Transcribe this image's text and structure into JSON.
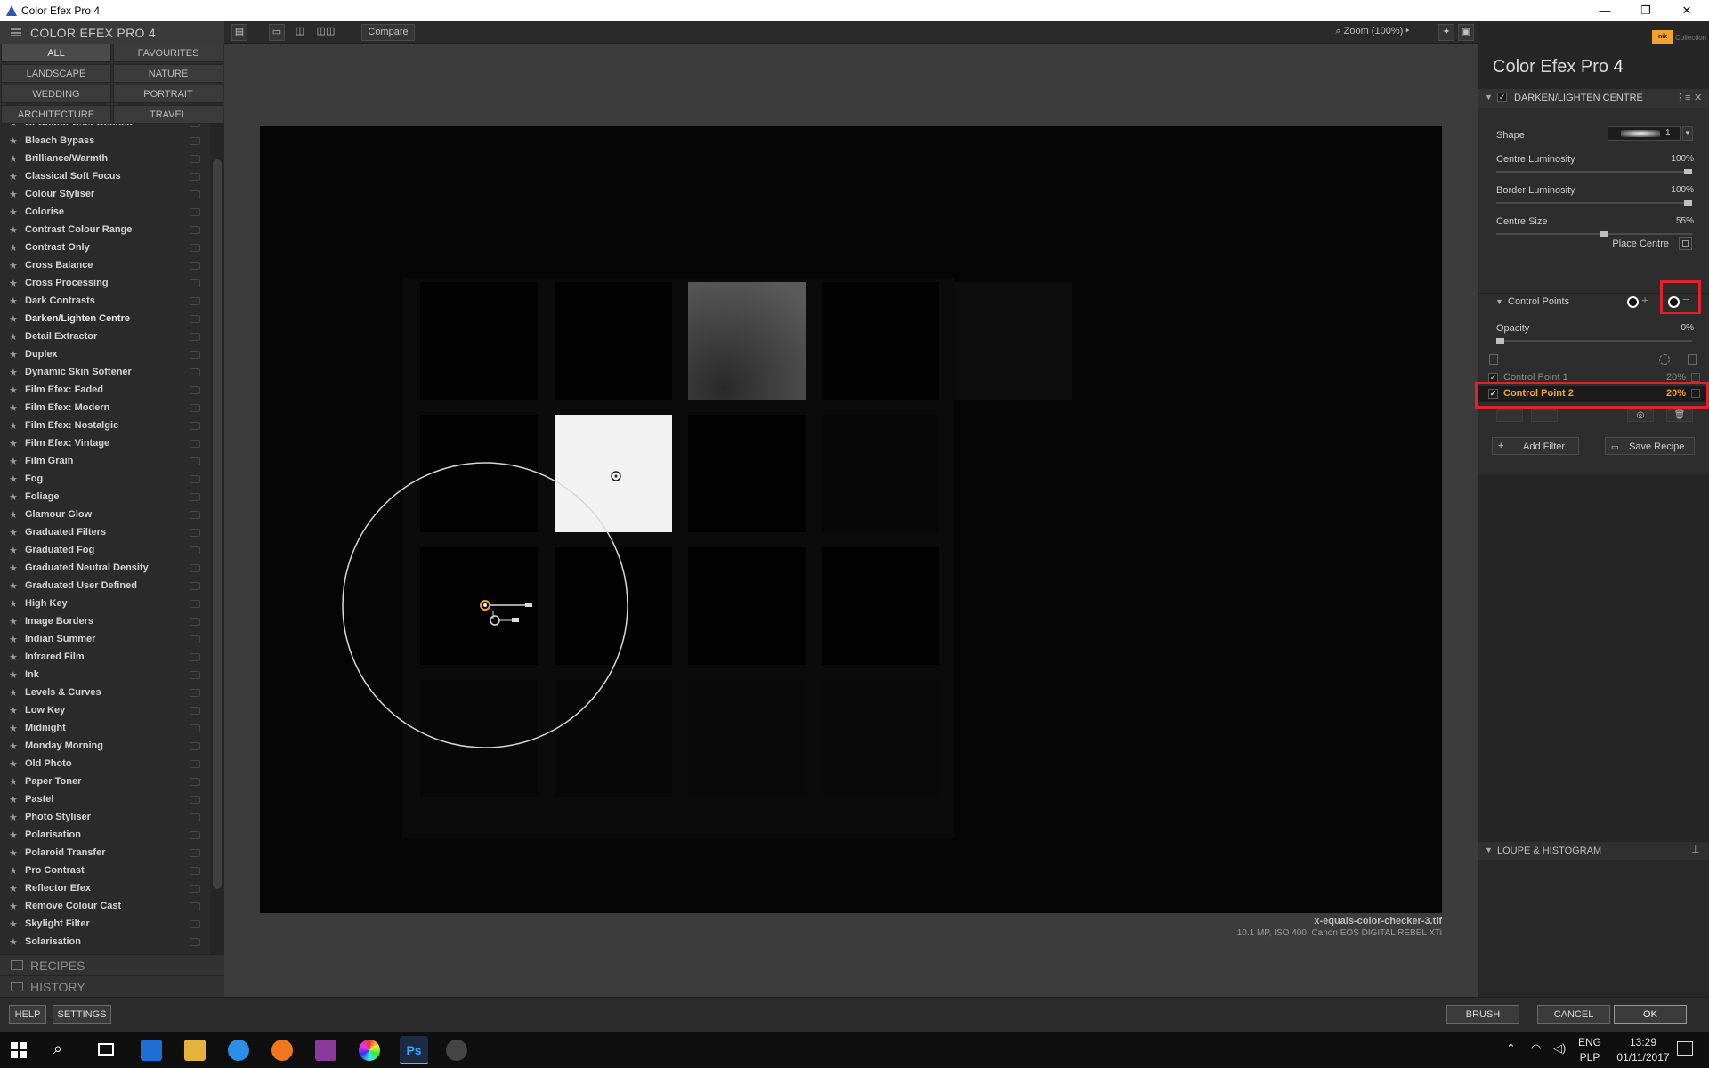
{
  "window": {
    "title": "Color Efex Pro 4",
    "buttons": [
      "—",
      "❐",
      "✕"
    ]
  },
  "left_panel": {
    "header": "COLOR EFEX PRO 4",
    "categories": [
      "ALL",
      "FAVOURITES",
      "LANDSCAPE",
      "NATURE",
      "WEDDING",
      "PORTRAIT",
      "ARCHITECTURE",
      "TRAVEL"
    ],
    "filters": [
      "Bi-Colour User Defined",
      "Bleach Bypass",
      "Brilliance/Warmth",
      "Classical Soft Focus",
      "Colour Styliser",
      "Colorise",
      "Contrast Colour Range",
      "Contrast Only",
      "Cross Balance",
      "Cross Processing",
      "Dark Contrasts",
      "Darken/Lighten Centre",
      "Detail Extractor",
      "Duplex",
      "Dynamic Skin Softener",
      "Film Efex: Faded",
      "Film Efex: Modern",
      "Film Efex: Nostalgic",
      "Film Efex: Vintage",
      "Film Grain",
      "Fog",
      "Foliage",
      "Glamour Glow",
      "Graduated Filters",
      "Graduated Fog",
      "Graduated Neutral Density",
      "Graduated User Defined",
      "High Key",
      "Image Borders",
      "Indian Summer",
      "Infrared Film",
      "Ink",
      "Levels & Curves",
      "Low Key",
      "Midnight",
      "Monday Morning",
      "Old Photo",
      "Paper Toner",
      "Pastel",
      "Photo Styliser",
      "Polarisation",
      "Polaroid Transfer",
      "Pro Contrast",
      "Reflector Efex",
      "Remove Colour Cast",
      "Skylight Filter",
      "Solarisation"
    ],
    "recipes_label": "RECIPES",
    "history_label": "HISTORY"
  },
  "toolbar": {
    "compare_label": "Compare",
    "zoom_label": "Zoom (100%)"
  },
  "image": {
    "filename": "x-equals-color-checker-3.tif",
    "meta": "10.1 MP, ISO 400, Canon EOS DIGITAL REBEL XTi"
  },
  "right_panel": {
    "brand": "Color Efex Pro",
    "brand_version": "4",
    "nik_label": "nik",
    "collection_label": "Collection",
    "filter_name": "DARKEN/LIGHTEN CENTRE",
    "shape_label": "Shape",
    "shape_value": "1",
    "params": [
      {
        "label": "Centre Luminosity",
        "value": "100%",
        "fraction": 1.0
      },
      {
        "label": "Border Luminosity",
        "value": "100%",
        "fraction": 1.0
      },
      {
        "label": "Centre Size",
        "value": "55%",
        "fraction": 0.55
      }
    ],
    "place_centre_label": "Place Centre",
    "control_points_label": "Control Points",
    "opacity_label": "Opacity",
    "opacity_value": "0%",
    "control_points": [
      {
        "name": "Control Point 1",
        "value": "20%",
        "selected": false
      },
      {
        "name": "Control Point 2",
        "value": "20%",
        "selected": true
      }
    ],
    "add_filter_label": "Add Filter",
    "save_recipe_label": "Save Recipe",
    "loupe_label": "LOUPE & HISTOGRAM"
  },
  "bottom_bar": {
    "help": "HELP",
    "settings": "SETTINGS",
    "brush": "BRUSH",
    "cancel": "CANCEL",
    "ok": "OK"
  },
  "taskbar": {
    "lang": "ENG",
    "layout": "PLP",
    "time": "13:29",
    "date": "01/11/2017"
  },
  "colors": {
    "highlight": "#f0a22a",
    "annotation": "#e0222b"
  }
}
